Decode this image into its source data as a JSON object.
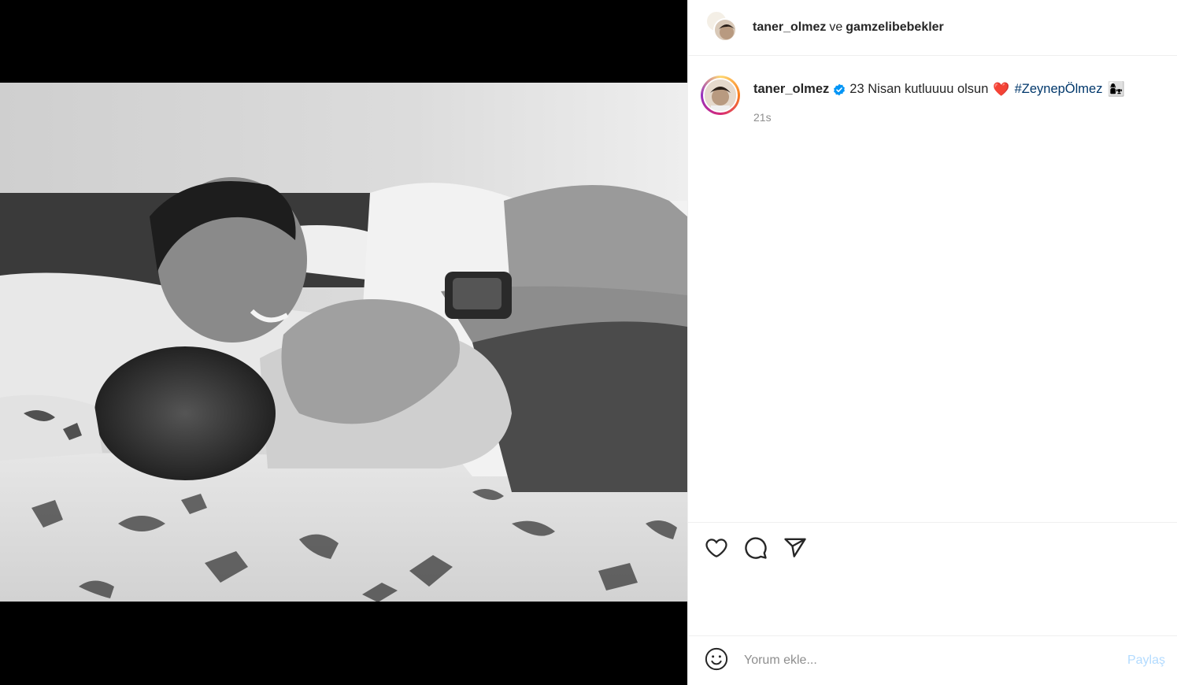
{
  "header": {
    "author": "taner_olmez",
    "conjunction": "ve",
    "collaborator": "gamzelibebekler"
  },
  "caption": {
    "username": "taner_olmez",
    "text": "23 Nisan kutluuuu olsun",
    "heart": "❤️",
    "hashtag": "#ZeynepÖlmez",
    "emoji": "👩‍👧",
    "time": "21s"
  },
  "actions": {
    "icons": [
      "heart-icon",
      "comment-icon",
      "share-icon"
    ]
  },
  "comment": {
    "placeholder": "Yorum ekle...",
    "post_label": "Paylaş"
  },
  "colors": {
    "hashtag": "#00376b",
    "secondary_text": "#8e8e8e",
    "post_button_disabled": "#b3dbff",
    "verified": "#0095f6"
  },
  "media": {
    "description_hidden": true
  }
}
